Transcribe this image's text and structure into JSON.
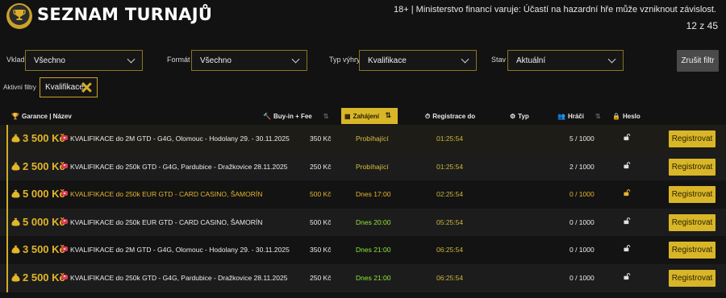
{
  "header": {
    "title": "SEZNAM TURNAJŮ",
    "warning": "18+ | Ministerstvo financí varuje: Účastí na hazardní hře může vzniknout závislost.",
    "count": "12 z 45"
  },
  "filters": {
    "vklad": {
      "label": "Vklad",
      "value": "Všechno"
    },
    "format": {
      "label": "Formát",
      "value": "Všechno"
    },
    "typ_vyhry": {
      "label": "Typ výhry",
      "value": "Kvalifikace"
    },
    "stav": {
      "label": "Stav",
      "value": "Aktuální"
    },
    "clear_label": "Zrušit filtr"
  },
  "active_filters": {
    "label": "Aktivní filtry",
    "chips": [
      "Kvalifikace"
    ]
  },
  "columns": {
    "garance": "Garance | Název",
    "buyin": "Buy-in + Fee",
    "zahajeni": "Zahájení",
    "registrace": "Registrace do",
    "typ": "Typ",
    "hraci": "Hráči",
    "heslo": "Heslo"
  },
  "colors": {
    "accent": "#d8b628",
    "gold_text": "#e2b629",
    "status_yellow": "#e6b52a",
    "status_green": "#8ee63a",
    "background": "#121212"
  },
  "icons": {
    "logo": "trophy-coin-icon",
    "garance": "trophy-icon",
    "buyin": "hammer-icon",
    "zahajeni": "calendar-icon",
    "registrace": "stopwatch-icon",
    "typ": "gear-icon",
    "hraci": "users-icon",
    "heslo": "lock-icon",
    "row_prize": "money-bag-icon",
    "row_stream": "youtube-icon",
    "row_lock": "unlocked-padlock-icon",
    "chip_remove": "close-icon"
  },
  "rows": [
    {
      "garance": "3 500 Kč",
      "name": "KVALIFIKACE do 2M GTD - G4G, Olomouc - Hodolany 29. - 30.11.2025",
      "buyin": "350 Kč",
      "start": "Probíhající",
      "start_color": "olive",
      "reg": "01:25:54",
      "players": "5 / 1000",
      "button": "Registrovat",
      "highlight": false
    },
    {
      "garance": "2 500 Kč",
      "name": "KVALIFIKACE do 250k GTD - G4G, Pardubice - Dražkovice 28.11.2025",
      "buyin": "250 Kč",
      "start": "Probíhající",
      "start_color": "olive",
      "reg": "01:25:54",
      "players": "2 / 1000",
      "button": "Registrovat",
      "highlight": false
    },
    {
      "garance": "5 000 Kč",
      "name": "KVALIFIKACE do 250k EUR GTD - CARD CASINO, ŠAMORÍN",
      "buyin": "500 Kč",
      "start": "Dnes 17:00",
      "start_color": "yellow",
      "reg": "02:25:54",
      "players": "0 / 1000",
      "button": "Registrovat",
      "highlight": true
    },
    {
      "garance": "5 000 Kč",
      "name": "KVALIFIKACE do 250k EUR GTD - CARD CASINO, ŠAMORÍN",
      "buyin": "500 Kč",
      "start": "Dnes 20:00",
      "start_color": "green",
      "reg": "05:25:54",
      "players": "0 / 1000",
      "button": "Registrovat",
      "highlight": false
    },
    {
      "garance": "3 500 Kč",
      "name": "KVALIFIKACE do 2M GTD - G4G, Olomouc - Hodolany 29. - 30.11.2025",
      "buyin": "350 Kč",
      "start": "Dnes 21:00",
      "start_color": "green",
      "reg": "06:25:54",
      "players": "0 / 1000",
      "button": "Registrovat",
      "highlight": false
    },
    {
      "garance": "2 500 Kč",
      "name": "KVALIFIKACE do 250k GTD - G4G, Pardubice - Dražkovice 28.11.2025",
      "buyin": "250 Kč",
      "start": "Dnes 21:00",
      "start_color": "green",
      "reg": "06:25:54",
      "players": "0 / 1000",
      "button": "Registrovat",
      "highlight": false
    }
  ]
}
